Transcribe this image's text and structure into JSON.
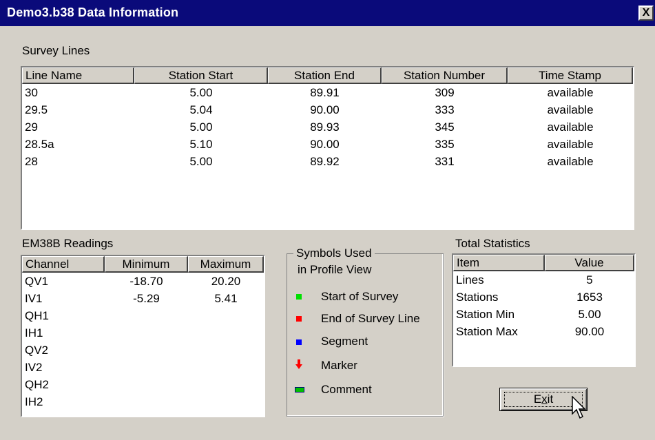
{
  "window": {
    "title": "Demo3.b38 Data Information",
    "close_glyph": "X"
  },
  "survey_lines": {
    "label": "Survey Lines",
    "columns": [
      "Line Name",
      "Station Start",
      "Station End",
      "Station Number",
      "Time Stamp"
    ],
    "rows": [
      [
        "30",
        "5.00",
        "89.91",
        "309",
        "available"
      ],
      [
        "29.5",
        "5.04",
        "90.00",
        "333",
        "available"
      ],
      [
        "29",
        "5.00",
        "89.93",
        "345",
        "available"
      ],
      [
        "28.5a",
        "5.10",
        "90.00",
        "335",
        "available"
      ],
      [
        "28",
        "5.00",
        "89.92",
        "331",
        "available"
      ]
    ]
  },
  "readings": {
    "label": "EM38B Readings",
    "columns": [
      "Channel",
      "Minimum",
      "Maximum"
    ],
    "rows": [
      [
        "QV1",
        "-18.70",
        "20.20"
      ],
      [
        "IV1",
        "-5.29",
        "5.41"
      ],
      [
        "QH1",
        "",
        ""
      ],
      [
        "IH1",
        "",
        ""
      ],
      [
        "QV2",
        "",
        ""
      ],
      [
        "IV2",
        "",
        ""
      ],
      [
        "QH2",
        "",
        ""
      ],
      [
        "IH2",
        "",
        ""
      ]
    ]
  },
  "symbols": {
    "title_line1": "Symbols Used",
    "title_line2": "in Profile View",
    "items": [
      {
        "label": "Start of Survey",
        "icon": "green-square-icon",
        "color": "#00e000"
      },
      {
        "label": "End of Survey Line",
        "icon": "red-square-icon",
        "color": "#ff0000"
      },
      {
        "label": "Segment",
        "icon": "blue-square-icon",
        "color": "#0000ff"
      },
      {
        "label": "Marker",
        "icon": "red-down-arrow-icon",
        "color": "#ff0000"
      },
      {
        "label": "Comment",
        "icon": "comment-box-icon",
        "color": "#00c000"
      }
    ]
  },
  "totals": {
    "label": "Total Statistics",
    "columns": [
      "Item",
      "Value"
    ],
    "rows": [
      [
        "Lines",
        "5"
      ],
      [
        "Stations",
        "1653"
      ],
      [
        "Station Min",
        "5.00"
      ],
      [
        "Station Max",
        "90.00"
      ]
    ]
  },
  "exit_button": {
    "label_pre": "E",
    "label_underlined": "x",
    "label_post": "it"
  }
}
